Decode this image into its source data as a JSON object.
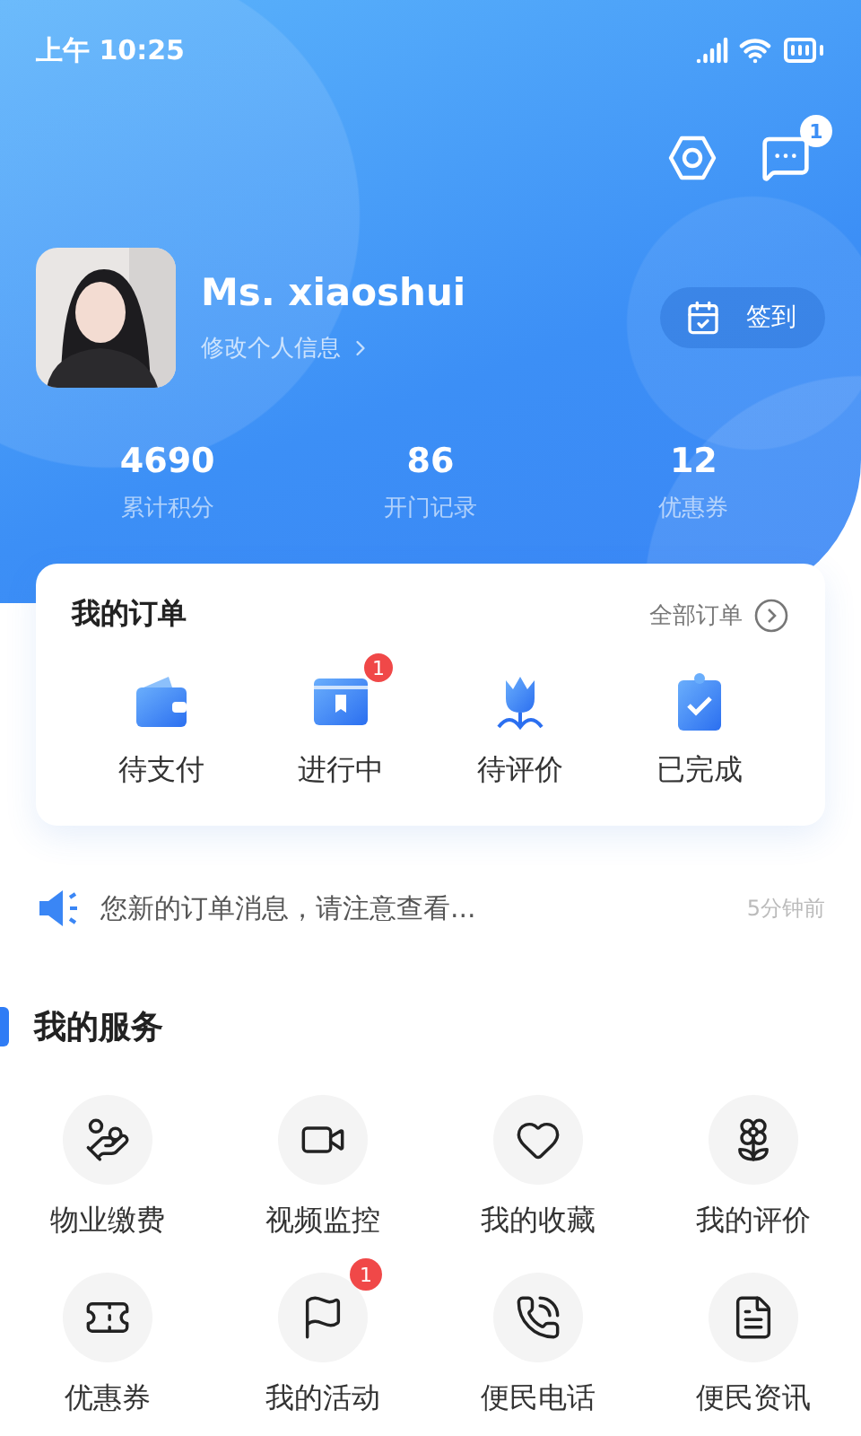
{
  "status_bar": {
    "time": "上午 10:25"
  },
  "header": {
    "message_badge": "1"
  },
  "profile": {
    "name": "Ms. xiaoshui",
    "edit_link": "修改个人信息",
    "checkin_button": "签到"
  },
  "stats": [
    {
      "value": "4690",
      "label": "累计积分"
    },
    {
      "value": "86",
      "label": "开门记录"
    },
    {
      "value": "12",
      "label": "优惠券"
    }
  ],
  "orders": {
    "title": "我的订单",
    "all_link": "全部订单",
    "items": [
      {
        "kind": "wallet",
        "label": "待支付"
      },
      {
        "kind": "book",
        "label": "进行中",
        "badge": "1"
      },
      {
        "kind": "tulip",
        "label": "待评价"
      },
      {
        "kind": "clipboard",
        "label": "已完成"
      }
    ]
  },
  "notice": {
    "text": "您新的订单消息，请注意查看...",
    "time": "5分钟前"
  },
  "services": {
    "title": "我的服务",
    "items": [
      {
        "kind": "payment",
        "label": "物业缴费"
      },
      {
        "kind": "video",
        "label": "视频监控"
      },
      {
        "kind": "heart",
        "label": "我的收藏"
      },
      {
        "kind": "flower",
        "label": "我的评价"
      },
      {
        "kind": "ticket",
        "label": "优惠券"
      },
      {
        "kind": "flag",
        "label": "我的活动",
        "badge": "1"
      },
      {
        "kind": "phone",
        "label": "便民电话"
      },
      {
        "kind": "document",
        "label": "便民资讯"
      }
    ]
  }
}
